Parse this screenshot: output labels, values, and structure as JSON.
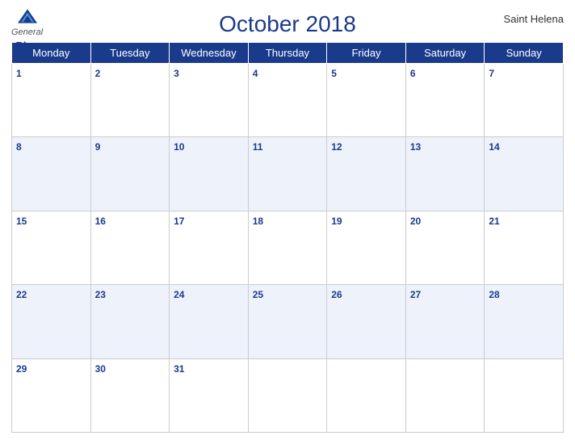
{
  "header": {
    "logo_general": "General",
    "logo_blue": "Blue",
    "month_year": "October 2018",
    "region": "Saint Helena"
  },
  "weekdays": [
    "Monday",
    "Tuesday",
    "Wednesday",
    "Thursday",
    "Friday",
    "Saturday",
    "Sunday"
  ],
  "weeks": [
    [
      1,
      2,
      3,
      4,
      5,
      6,
      7
    ],
    [
      8,
      9,
      10,
      11,
      12,
      13,
      14
    ],
    [
      15,
      16,
      17,
      18,
      19,
      20,
      21
    ],
    [
      22,
      23,
      24,
      25,
      26,
      27,
      28
    ],
    [
      29,
      30,
      31,
      null,
      null,
      null,
      null
    ]
  ],
  "row_shading": [
    false,
    true,
    false,
    true,
    false
  ]
}
